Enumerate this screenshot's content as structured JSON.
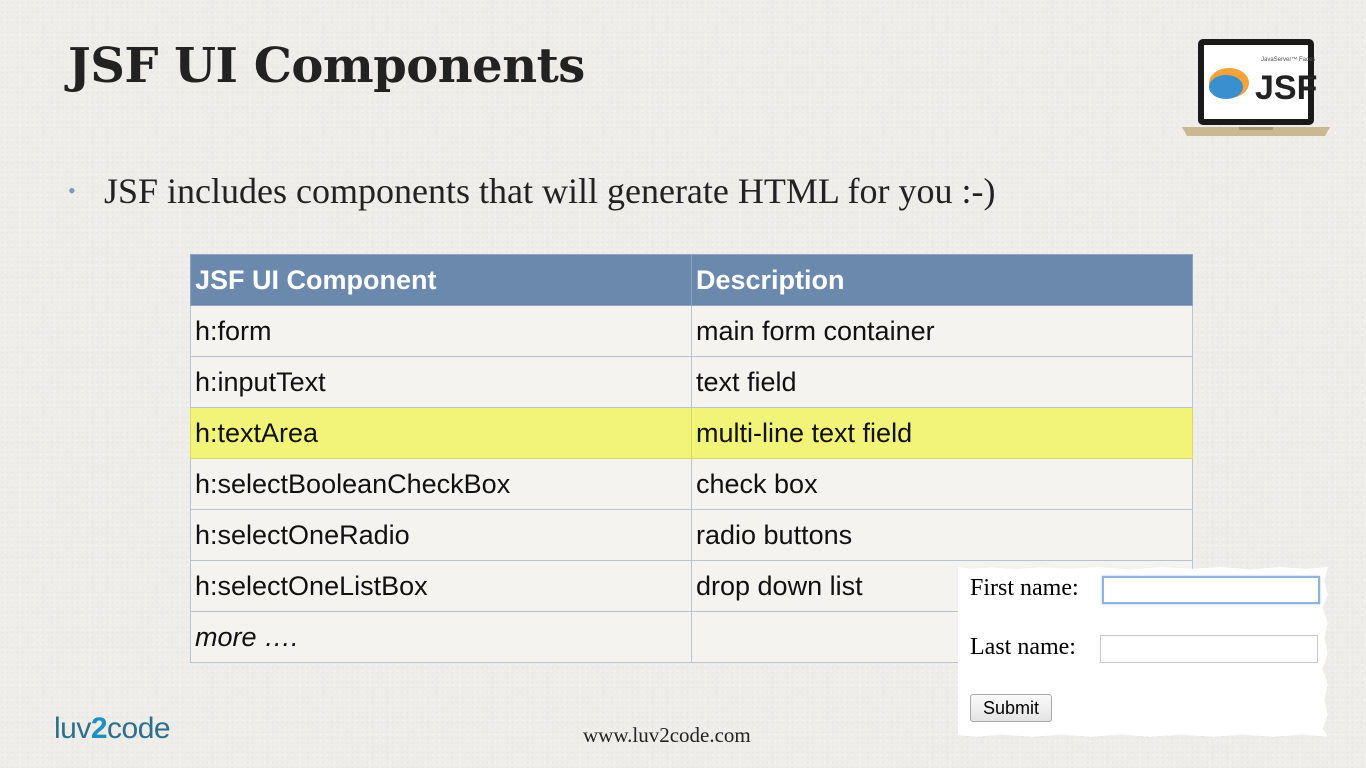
{
  "slide": {
    "title": "JSF UI Components",
    "bullet": "JSF includes components that will generate HTML for you :-)"
  },
  "logo": {
    "text": "JSF",
    "small_text": "JavaServer™ Faces",
    "icon": "laptop-jsf-logo-icon"
  },
  "table": {
    "headers": [
      "JSF UI Component",
      "Description"
    ],
    "rows": [
      [
        "h:form",
        "main form container"
      ],
      [
        "h:inputText",
        "text field"
      ],
      [
        "h:textArea",
        "multi-line text field"
      ],
      [
        "h:selectBooleanCheckBox",
        "check box"
      ],
      [
        "h:selectOneRadio",
        "radio buttons"
      ],
      [
        "h:selectOneListBox",
        "drop down list"
      ],
      [
        "more ….",
        ""
      ]
    ],
    "highlight_color": "#f2f47a",
    "header_color": "#6a89ad"
  },
  "form_example": {
    "first_name_label": "First name:",
    "first_name_value": "",
    "last_name_label": "Last name:",
    "last_name_value": "",
    "submit_label": "Submit"
  },
  "footer": {
    "brand_pre": "luv",
    "brand_two": "2",
    "brand_post": "code",
    "url": "www.luv2code.com"
  }
}
